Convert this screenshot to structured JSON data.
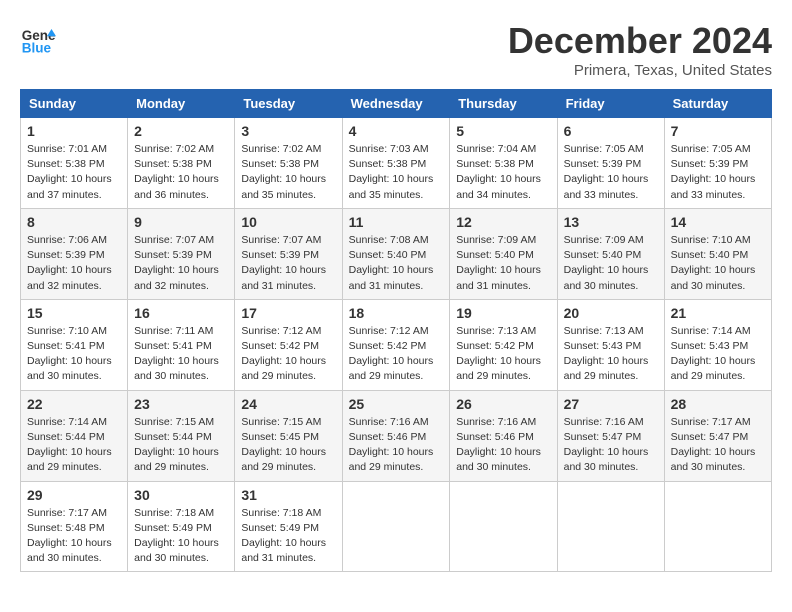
{
  "logo": {
    "text_general": "General",
    "text_blue": "Blue"
  },
  "title": "December 2024",
  "location": "Primera, Texas, United States",
  "days_of_week": [
    "Sunday",
    "Monday",
    "Tuesday",
    "Wednesday",
    "Thursday",
    "Friday",
    "Saturday"
  ],
  "weeks": [
    [
      {
        "day": "1",
        "sunrise": "Sunrise: 7:01 AM",
        "sunset": "Sunset: 5:38 PM",
        "daylight": "Daylight: 10 hours and 37 minutes."
      },
      {
        "day": "2",
        "sunrise": "Sunrise: 7:02 AM",
        "sunset": "Sunset: 5:38 PM",
        "daylight": "Daylight: 10 hours and 36 minutes."
      },
      {
        "day": "3",
        "sunrise": "Sunrise: 7:02 AM",
        "sunset": "Sunset: 5:38 PM",
        "daylight": "Daylight: 10 hours and 35 minutes."
      },
      {
        "day": "4",
        "sunrise": "Sunrise: 7:03 AM",
        "sunset": "Sunset: 5:38 PM",
        "daylight": "Daylight: 10 hours and 35 minutes."
      },
      {
        "day": "5",
        "sunrise": "Sunrise: 7:04 AM",
        "sunset": "Sunset: 5:38 PM",
        "daylight": "Daylight: 10 hours and 34 minutes."
      },
      {
        "day": "6",
        "sunrise": "Sunrise: 7:05 AM",
        "sunset": "Sunset: 5:39 PM",
        "daylight": "Daylight: 10 hours and 33 minutes."
      },
      {
        "day": "7",
        "sunrise": "Sunrise: 7:05 AM",
        "sunset": "Sunset: 5:39 PM",
        "daylight": "Daylight: 10 hours and 33 minutes."
      }
    ],
    [
      {
        "day": "8",
        "sunrise": "Sunrise: 7:06 AM",
        "sunset": "Sunset: 5:39 PM",
        "daylight": "Daylight: 10 hours and 32 minutes."
      },
      {
        "day": "9",
        "sunrise": "Sunrise: 7:07 AM",
        "sunset": "Sunset: 5:39 PM",
        "daylight": "Daylight: 10 hours and 32 minutes."
      },
      {
        "day": "10",
        "sunrise": "Sunrise: 7:07 AM",
        "sunset": "Sunset: 5:39 PM",
        "daylight": "Daylight: 10 hours and 31 minutes."
      },
      {
        "day": "11",
        "sunrise": "Sunrise: 7:08 AM",
        "sunset": "Sunset: 5:40 PM",
        "daylight": "Daylight: 10 hours and 31 minutes."
      },
      {
        "day": "12",
        "sunrise": "Sunrise: 7:09 AM",
        "sunset": "Sunset: 5:40 PM",
        "daylight": "Daylight: 10 hours and 31 minutes."
      },
      {
        "day": "13",
        "sunrise": "Sunrise: 7:09 AM",
        "sunset": "Sunset: 5:40 PM",
        "daylight": "Daylight: 10 hours and 30 minutes."
      },
      {
        "day": "14",
        "sunrise": "Sunrise: 7:10 AM",
        "sunset": "Sunset: 5:40 PM",
        "daylight": "Daylight: 10 hours and 30 minutes."
      }
    ],
    [
      {
        "day": "15",
        "sunrise": "Sunrise: 7:10 AM",
        "sunset": "Sunset: 5:41 PM",
        "daylight": "Daylight: 10 hours and 30 minutes."
      },
      {
        "day": "16",
        "sunrise": "Sunrise: 7:11 AM",
        "sunset": "Sunset: 5:41 PM",
        "daylight": "Daylight: 10 hours and 30 minutes."
      },
      {
        "day": "17",
        "sunrise": "Sunrise: 7:12 AM",
        "sunset": "Sunset: 5:42 PM",
        "daylight": "Daylight: 10 hours and 29 minutes."
      },
      {
        "day": "18",
        "sunrise": "Sunrise: 7:12 AM",
        "sunset": "Sunset: 5:42 PM",
        "daylight": "Daylight: 10 hours and 29 minutes."
      },
      {
        "day": "19",
        "sunrise": "Sunrise: 7:13 AM",
        "sunset": "Sunset: 5:42 PM",
        "daylight": "Daylight: 10 hours and 29 minutes."
      },
      {
        "day": "20",
        "sunrise": "Sunrise: 7:13 AM",
        "sunset": "Sunset: 5:43 PM",
        "daylight": "Daylight: 10 hours and 29 minutes."
      },
      {
        "day": "21",
        "sunrise": "Sunrise: 7:14 AM",
        "sunset": "Sunset: 5:43 PM",
        "daylight": "Daylight: 10 hours and 29 minutes."
      }
    ],
    [
      {
        "day": "22",
        "sunrise": "Sunrise: 7:14 AM",
        "sunset": "Sunset: 5:44 PM",
        "daylight": "Daylight: 10 hours and 29 minutes."
      },
      {
        "day": "23",
        "sunrise": "Sunrise: 7:15 AM",
        "sunset": "Sunset: 5:44 PM",
        "daylight": "Daylight: 10 hours and 29 minutes."
      },
      {
        "day": "24",
        "sunrise": "Sunrise: 7:15 AM",
        "sunset": "Sunset: 5:45 PM",
        "daylight": "Daylight: 10 hours and 29 minutes."
      },
      {
        "day": "25",
        "sunrise": "Sunrise: 7:16 AM",
        "sunset": "Sunset: 5:46 PM",
        "daylight": "Daylight: 10 hours and 29 minutes."
      },
      {
        "day": "26",
        "sunrise": "Sunrise: 7:16 AM",
        "sunset": "Sunset: 5:46 PM",
        "daylight": "Daylight: 10 hours and 30 minutes."
      },
      {
        "day": "27",
        "sunrise": "Sunrise: 7:16 AM",
        "sunset": "Sunset: 5:47 PM",
        "daylight": "Daylight: 10 hours and 30 minutes."
      },
      {
        "day": "28",
        "sunrise": "Sunrise: 7:17 AM",
        "sunset": "Sunset: 5:47 PM",
        "daylight": "Daylight: 10 hours and 30 minutes."
      }
    ],
    [
      {
        "day": "29",
        "sunrise": "Sunrise: 7:17 AM",
        "sunset": "Sunset: 5:48 PM",
        "daylight": "Daylight: 10 hours and 30 minutes."
      },
      {
        "day": "30",
        "sunrise": "Sunrise: 7:18 AM",
        "sunset": "Sunset: 5:49 PM",
        "daylight": "Daylight: 10 hours and 30 minutes."
      },
      {
        "day": "31",
        "sunrise": "Sunrise: 7:18 AM",
        "sunset": "Sunset: 5:49 PM",
        "daylight": "Daylight: 10 hours and 31 minutes."
      },
      null,
      null,
      null,
      null
    ]
  ]
}
